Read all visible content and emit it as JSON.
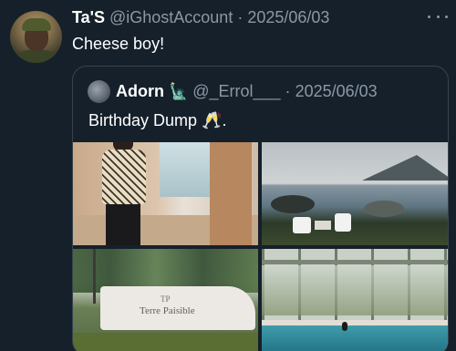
{
  "tweet": {
    "author_name": "Ta'S",
    "author_handle": "@iGhostAccount",
    "separator": "·",
    "date": "2025/06/03",
    "text": "Cheese boy!"
  },
  "quoted_tweet": {
    "author_name": "Adorn",
    "name_emoji": "🗽",
    "author_handle": "@_Errol___",
    "separator": "·",
    "date": "2025/06/03",
    "text": "Birthday Dump",
    "text_emoji": "🥂",
    "text_suffix": ".",
    "sign_text": "Terre Paisible",
    "sign_mark": "TP"
  },
  "colors": {
    "background": "#15202b",
    "text_primary": "#ffffff",
    "text_secondary": "#8b98a5",
    "border": "#38444d"
  },
  "icons": {
    "more": "more-horizontal-icon"
  }
}
